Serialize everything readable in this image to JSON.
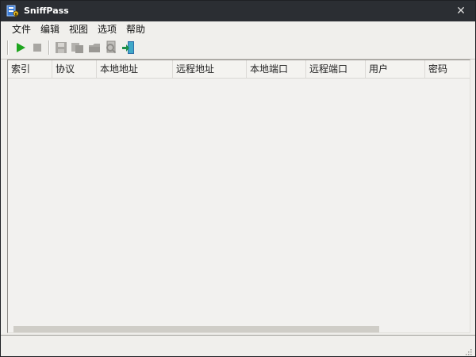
{
  "window": {
    "title": "SniffPass",
    "close_glyph": "✕"
  },
  "menu": {
    "items": [
      {
        "label": "文件"
      },
      {
        "label": "编辑"
      },
      {
        "label": "视图"
      },
      {
        "label": "选项"
      },
      {
        "label": "帮助"
      }
    ]
  },
  "toolbar": {
    "buttons": [
      {
        "icon": "play-icon",
        "enabled": true
      },
      {
        "icon": "stop-icon",
        "enabled": false
      },
      {
        "icon": "save-icon",
        "enabled": false
      },
      {
        "icon": "copy-icon",
        "enabled": false
      },
      {
        "icon": "folder-icon",
        "enabled": false
      },
      {
        "icon": "properties-icon",
        "enabled": false
      },
      {
        "icon": "exit-icon",
        "enabled": true
      }
    ]
  },
  "table": {
    "columns": [
      {
        "label": "索引"
      },
      {
        "label": "协议"
      },
      {
        "label": "本地地址"
      },
      {
        "label": "远程地址"
      },
      {
        "label": "本地端口"
      },
      {
        "label": "远程端口"
      },
      {
        "label": "用户"
      },
      {
        "label": "密码"
      }
    ],
    "rows": []
  },
  "status": {
    "text": ""
  },
  "colors": {
    "titlebar": "#2b2e33",
    "window_bg": "#f0efec",
    "play_green": "#1ea51e"
  }
}
